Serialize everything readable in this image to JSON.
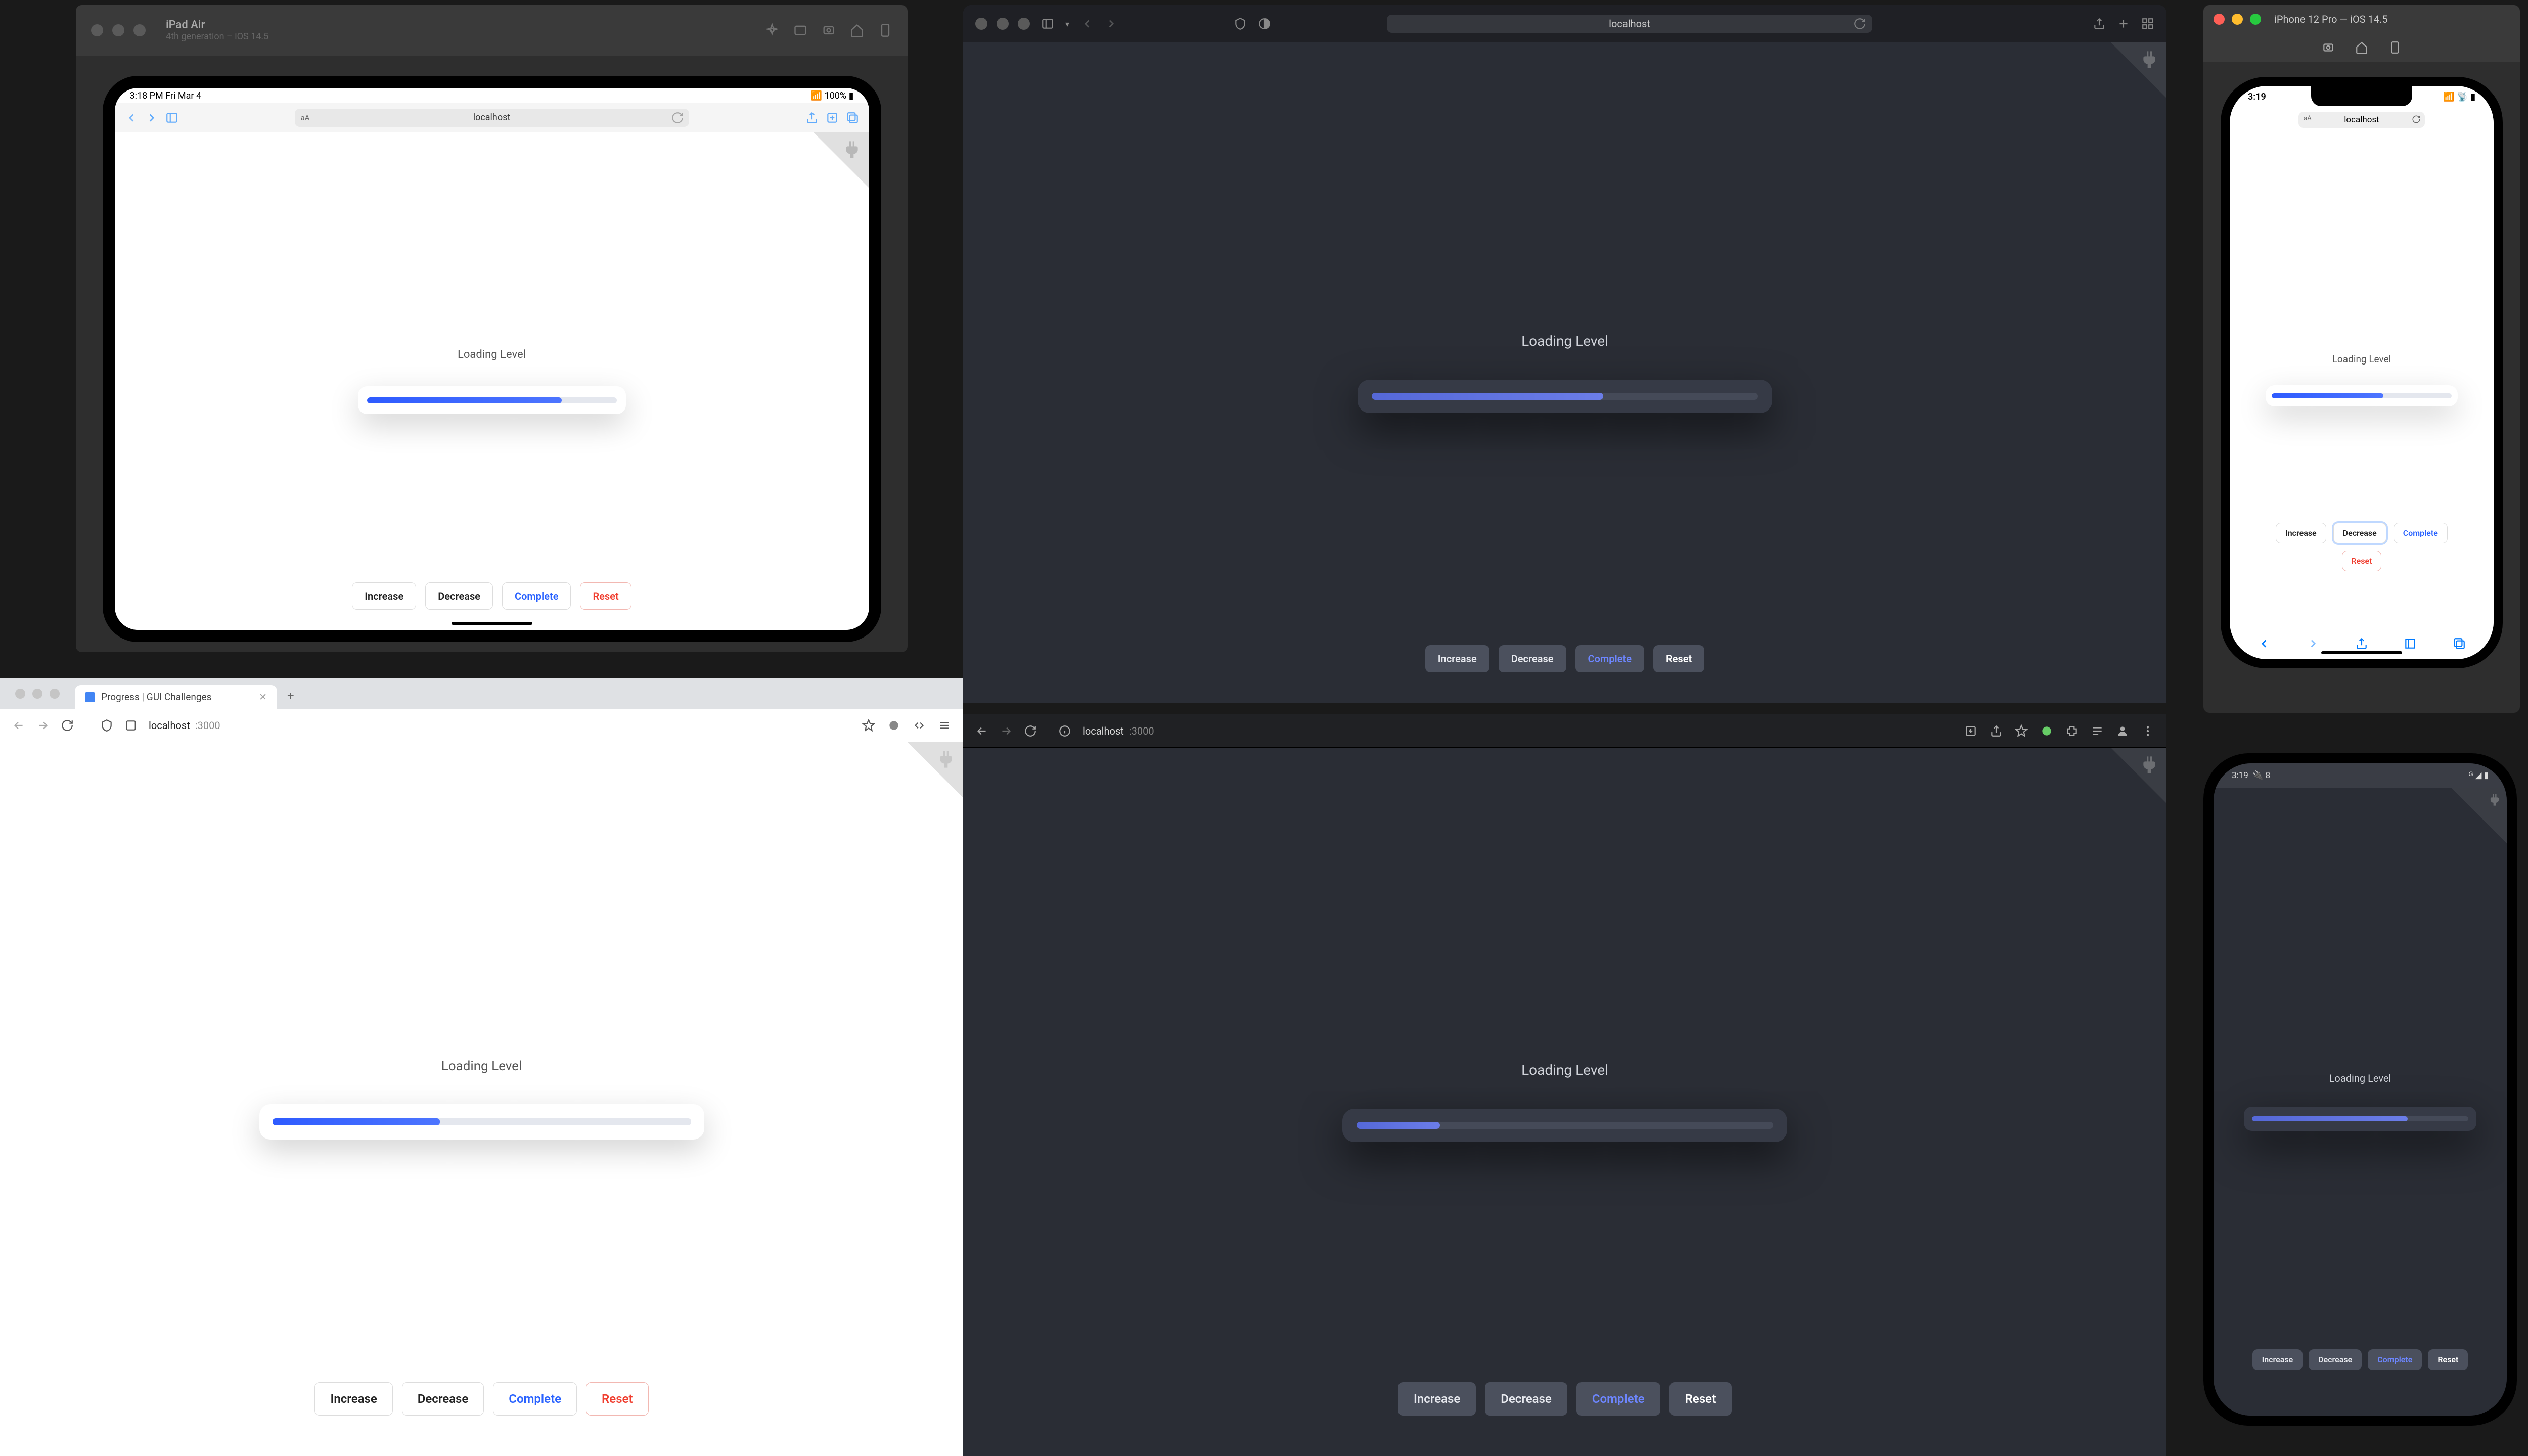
{
  "app": {
    "loading_label": "Loading Level",
    "buttons": {
      "increase": "Increase",
      "decrease": "Decrease",
      "complete": "Complete",
      "reset": "Reset"
    }
  },
  "progress": {
    "ipad_pct": 78,
    "safari_desktop_pct": 60,
    "iphone_pct": 62,
    "chrome_light_pct": 40,
    "chrome_dark_pct": 20,
    "android_pct": 72
  },
  "ipad_sim": {
    "device_name": "iPad Air",
    "device_sub": "4th generation – iOS 14.5",
    "status_left": "3:18 PM   Fri Mar 4",
    "status_right": "100%",
    "url": "localhost",
    "aa": "aA"
  },
  "safari_desktop": {
    "url": "localhost"
  },
  "iphone_sim": {
    "title": "iPhone 12 Pro — iOS 14.5",
    "time": "3:19",
    "url": "localhost",
    "aa": "aA"
  },
  "chrome_light": {
    "tab_title": "Progress | GUI Challenges",
    "host": "localhost",
    "port": ":3000"
  },
  "chrome_dark": {
    "host": "localhost",
    "port": ":3000"
  },
  "android": {
    "time": "3:19",
    "status_icon": "8"
  },
  "colors": {
    "accent_blue": "#2962ff",
    "accent_red": "#f03e2f",
    "dark_bg": "#2a2d35",
    "progress_light": "#2e5bff",
    "progress_dark": "#5568d8"
  }
}
